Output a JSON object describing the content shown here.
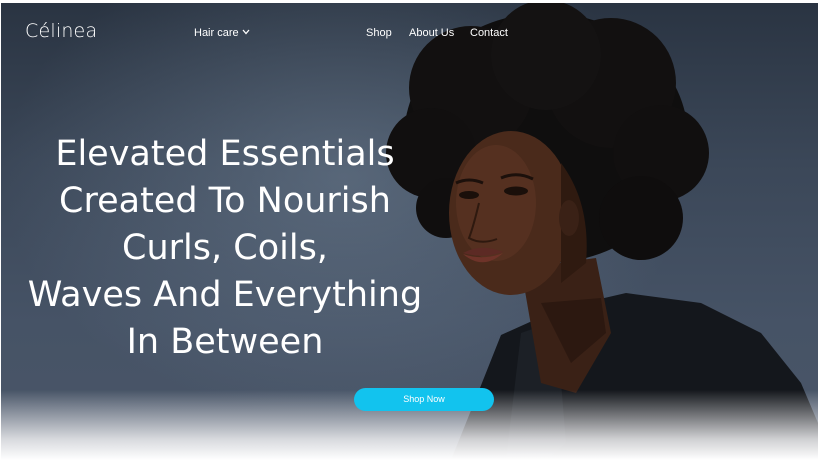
{
  "brand": {
    "logo_text": "Célinea"
  },
  "nav": {
    "haircare_label": "Hair care",
    "haircare_icon": "chevron-down-icon",
    "shop_label": "Shop",
    "about_label": "About Us",
    "contact_label": "Contact"
  },
  "hero": {
    "headline_lines": [
      "Elevated Essentials",
      "Created To Nourish",
      "Curls, Coils,",
      "Waves And Everything",
      "In Between"
    ],
    "cta_label": "Shop Now"
  },
  "colors": {
    "accent": "#12c3ee",
    "text_on_hero": "#ffffff",
    "background": "#2e3a4a"
  }
}
